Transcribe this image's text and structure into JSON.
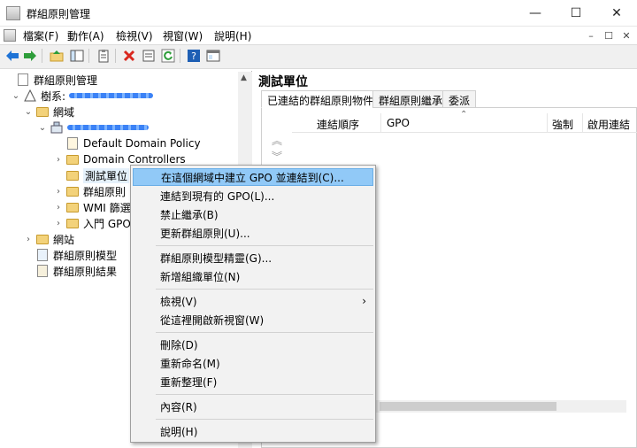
{
  "window": {
    "title": "群組原則管理",
    "controls": {
      "minimize": "—",
      "maximize": "☐",
      "close": "✕"
    }
  },
  "menu": [
    "檔案(F)",
    "動作(A)",
    "檢視(V)",
    "視窗(W)",
    "說明(H)"
  ],
  "mdi_controls": [
    "–",
    "☐",
    "✕"
  ],
  "tree": {
    "root": "群組原則管理",
    "forest_label": "樹系:",
    "domains": "網域",
    "items": [
      "Default Domain Policy",
      "Domain Controllers",
      "測試單位",
      "群組原則",
      "WMI 篩選",
      "入門 GPO"
    ],
    "sites": "網站",
    "modeling": "群組原則模型",
    "results": "群組原則結果"
  },
  "right": {
    "title": "測試單位",
    "tabs": [
      "已連結的群組原則物件",
      "群組原則繼承",
      "委派"
    ],
    "columns": [
      "連結順序",
      "GPO",
      "強制",
      "啟用連結"
    ]
  },
  "context_menu": [
    {
      "label": "在這個網域中建立 GPO 並連結到(C)...",
      "highlight": true
    },
    {
      "label": "連結到現有的 GPO(L)..."
    },
    {
      "label": "禁止繼承(B)"
    },
    {
      "label": "更新群組原則(U)..."
    },
    {
      "sep": true
    },
    {
      "label": "群組原則模型精靈(G)..."
    },
    {
      "label": "新增組織單位(N)"
    },
    {
      "sep": true
    },
    {
      "label": "檢視(V)",
      "submenu": true
    },
    {
      "label": "從這裡開啟新視窗(W)"
    },
    {
      "sep": true
    },
    {
      "label": "刪除(D)"
    },
    {
      "label": "重新命名(M)"
    },
    {
      "label": "重新整理(F)"
    },
    {
      "sep": true
    },
    {
      "label": "內容(R)"
    },
    {
      "sep": true
    },
    {
      "label": "說明(H)"
    }
  ],
  "icons": {
    "back": "arrow-left-icon",
    "forward": "arrow-right-icon",
    "up": "folder-up-icon",
    "show-tree": "tree-toggle-icon",
    "properties": "clipboard-icon",
    "delete": "delete-icon",
    "copy": "copy-icon",
    "refresh": "refresh-icon",
    "help": "help-icon",
    "console": "console-icon"
  },
  "colors": {
    "highlight": "#91c9f7",
    "delete": "#d9281f",
    "back": "#1e73d6",
    "forward": "#2e9d3a"
  }
}
